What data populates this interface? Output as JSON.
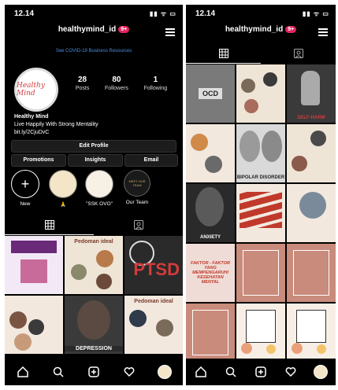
{
  "left": {
    "status": {
      "time": "12.14",
      "icons": "▮▮ ᯤ ▭"
    },
    "username": "healthymind_id",
    "badge": "9+",
    "covid_link": "See COVID-19 Business Resources",
    "avatar_text": "Healthy Mind",
    "stats": [
      {
        "number": "28",
        "label": "Posts"
      },
      {
        "number": "80",
        "label": "Followers"
      },
      {
        "number": "1",
        "label": "Following"
      }
    ],
    "bio": {
      "name": "Healthy Mind",
      "line": "Live Happily With Strong Mentality",
      "link": "bit.ly/2CjuDvC"
    },
    "edit_profile": "Edit Profile",
    "promotions": "Promotions",
    "insights": "Insights",
    "email": "Email",
    "highlights": [
      {
        "label": "New",
        "icon": "+"
      },
      {
        "label": "🙏",
        "icon": ""
      },
      {
        "label": "\"SSK OVO\"",
        "icon": ""
      },
      {
        "label": "Our Team",
        "icon": "MEET OUR TEAM"
      }
    ],
    "tiles": [
      {
        "text": "",
        "caption": ""
      },
      {
        "text": "Pedoman ideal",
        "caption": ""
      },
      {
        "text": "PTSD",
        "caption": ""
      },
      {
        "text": "",
        "caption": ""
      },
      {
        "text": "",
        "caption": "DEPRESSION"
      },
      {
        "text": "Pedoman ideal",
        "caption": ""
      }
    ]
  },
  "right": {
    "status": {
      "time": "12.14",
      "icons": "▮▮ ᯤ ▭"
    },
    "username": "healthymind_id",
    "badge": "9+",
    "tiles": [
      {
        "text": "OCD",
        "caption": ""
      },
      {
        "text": "",
        "caption": ""
      },
      {
        "text": "",
        "caption": "SELF-HARM"
      },
      {
        "text": "",
        "caption": ""
      },
      {
        "text": "",
        "caption": "BIPOLAR DISORDER"
      },
      {
        "text": "",
        "caption": ""
      },
      {
        "text": "",
        "caption": "ANXIETY"
      },
      {
        "text": "",
        "caption": ""
      },
      {
        "text": "",
        "caption": ""
      },
      {
        "text": "FAKTOR - FAKTOR YANG MEMPENGARUHI KESEHATAN MENTAL",
        "caption": ""
      },
      {
        "text": "",
        "caption": ""
      },
      {
        "text": "",
        "caption": ""
      },
      {
        "text": "",
        "caption": ""
      },
      {
        "text": "",
        "caption": ""
      },
      {
        "text": "",
        "caption": ""
      }
    ]
  },
  "colors": {
    "accent_link": "#4a90e2",
    "badge": "#e0245e",
    "tile_beige": "#efe5d6",
    "tile_pink": "#c98b7b"
  }
}
